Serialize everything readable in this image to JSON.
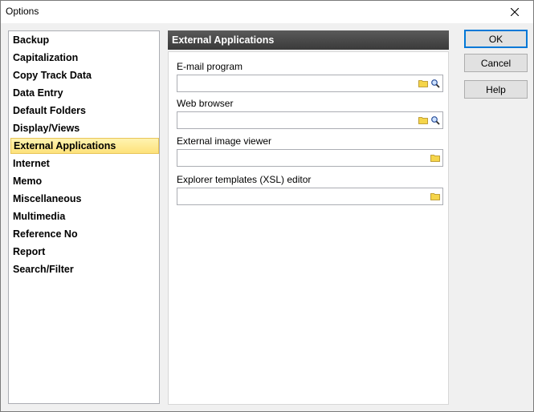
{
  "window": {
    "title": "Options"
  },
  "categories": [
    "Backup",
    "Capitalization",
    "Copy Track Data",
    "Data Entry",
    "Default Folders",
    "Display/Views",
    "External Applications",
    "Internet",
    "Memo",
    "Miscellaneous",
    "Multimedia",
    "Reference No",
    "Report",
    "Search/Filter"
  ],
  "selected_category": "External Applications",
  "panel": {
    "title": "External Applications",
    "fields": [
      {
        "label": "E-mail program",
        "value": "",
        "icons": [
          "folder-icon",
          "search-icon"
        ]
      },
      {
        "label": "Web browser",
        "value": "",
        "icons": [
          "folder-icon",
          "search-icon"
        ]
      },
      {
        "label": "External image viewer",
        "value": "",
        "icons": [
          "folder-icon"
        ]
      },
      {
        "label": "Explorer templates (XSL) editor",
        "value": "",
        "icons": [
          "folder-icon"
        ]
      }
    ]
  },
  "buttons": {
    "ok": "OK",
    "cancel": "Cancel",
    "help": "Help"
  },
  "colors": {
    "header_bg": "#4a4a4a",
    "selection_bg": "#fde27a",
    "folder_icon": "#f5d54a"
  }
}
